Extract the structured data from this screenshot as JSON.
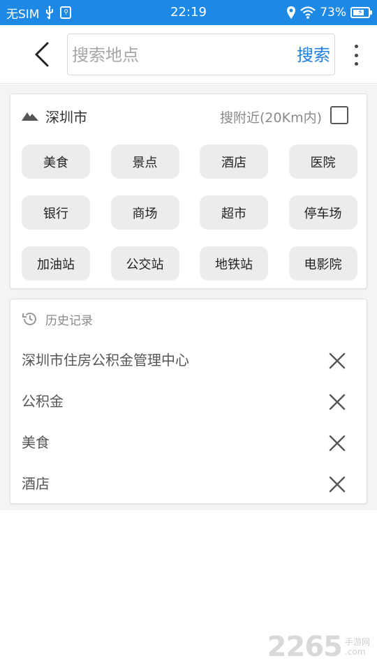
{
  "status_bar": {
    "carrier": "无SIM",
    "time": "22:19",
    "battery_percent": "73%",
    "battery_level": 0.73,
    "icons": [
      "usb-icon",
      "usb-debug-icon",
      "location-icon",
      "wifi-icon",
      "battery-charging-icon"
    ]
  },
  "header": {
    "search_placeholder": "搜索地点",
    "search_value": "",
    "search_button": "搜索",
    "icons": [
      "back-chevron-icon",
      "more-vertical-icon"
    ]
  },
  "category_card": {
    "city": "深圳市",
    "nearby_label": "搜附近(20Km内)",
    "nearby_checked": false,
    "categories": [
      "美食",
      "景点",
      "酒店",
      "医院",
      "银行",
      "商场",
      "超市",
      "停车场",
      "加油站",
      "公交站",
      "地铁站",
      "电影院"
    ]
  },
  "history": {
    "title": "历史记录",
    "items": [
      "深圳市住房公积金管理中心",
      "公积金",
      "美食",
      "酒店"
    ]
  },
  "watermark": {
    "number": "2265",
    "text_top": "手游网",
    "text_bottom": ".com"
  },
  "colors": {
    "status_bar": "#1e88e5",
    "accent": "#1e7fe0",
    "chip_bg": "#ececec",
    "page_bg": "#f4f4f4"
  }
}
